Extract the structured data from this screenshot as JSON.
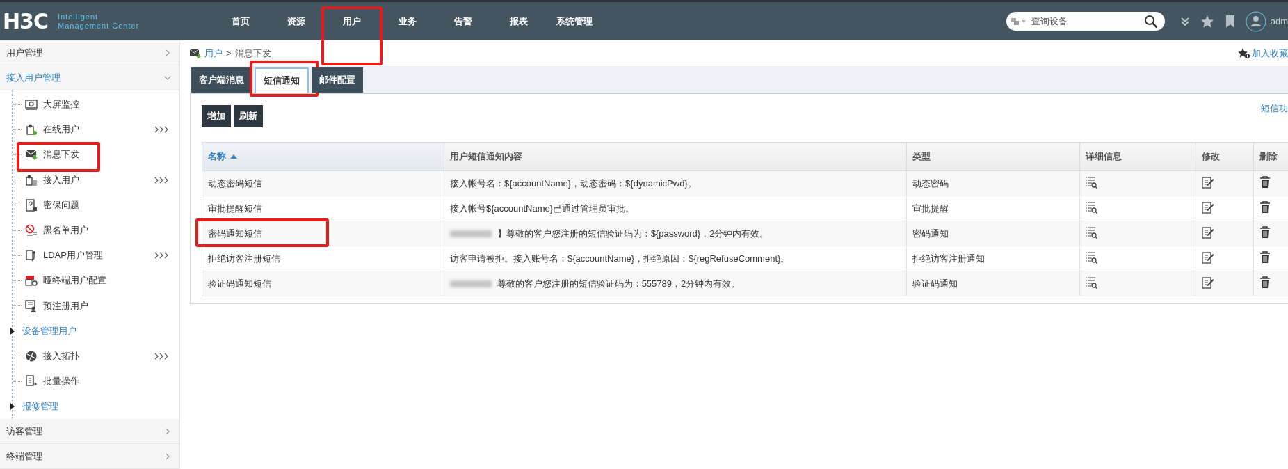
{
  "header": {
    "logo": "H3C",
    "product_line1": "Intelligent",
    "product_line2": "Management Center",
    "nav": [
      {
        "label": "首页",
        "highlighted": false
      },
      {
        "label": "资源",
        "highlighted": false
      },
      {
        "label": "用户",
        "highlighted": true
      },
      {
        "label": "业务",
        "highlighted": false
      },
      {
        "label": "告警",
        "highlighted": false
      },
      {
        "label": "报表",
        "highlighted": false
      },
      {
        "label": "系统管理",
        "highlighted": false
      }
    ],
    "search": {
      "placeholder": "查询设备"
    },
    "user": "adm"
  },
  "sidebar": {
    "groups": [
      {
        "label": "用户管理",
        "expanded": false
      },
      {
        "label": "接入用户管理",
        "expanded": true,
        "children": [
          {
            "kind": "item",
            "label": "大屏监控",
            "more": false,
            "highlighted": false
          },
          {
            "kind": "item",
            "label": "在线用户",
            "more": true,
            "highlighted": false
          },
          {
            "kind": "item",
            "label": "消息下发",
            "more": false,
            "highlighted": true
          },
          {
            "kind": "item",
            "label": "接入用户",
            "more": true,
            "highlighted": false
          },
          {
            "kind": "item",
            "label": "密保问题",
            "more": false,
            "highlighted": false
          },
          {
            "kind": "item",
            "label": "黑名单用户",
            "more": false,
            "highlighted": false
          },
          {
            "kind": "item",
            "label": "LDAP用户管理",
            "more": true,
            "highlighted": false
          },
          {
            "kind": "item",
            "label": "哑终端用户配置",
            "more": false,
            "highlighted": false
          },
          {
            "kind": "item",
            "label": "预注册用户",
            "more": false,
            "highlighted": false
          },
          {
            "kind": "group",
            "label": "设备管理用户",
            "expanded": false
          },
          {
            "kind": "item",
            "label": "接入拓扑",
            "more": true,
            "highlighted": false
          },
          {
            "kind": "item",
            "label": "批量操作",
            "more": false,
            "highlighted": false
          },
          {
            "kind": "group",
            "label": "报修管理",
            "expanded": false
          }
        ]
      },
      {
        "label": "访客管理",
        "expanded": false
      },
      {
        "label": "终端管理",
        "expanded": false
      }
    ]
  },
  "breadcrumb": {
    "items": [
      "用户",
      "消息下发"
    ],
    "separator": ">"
  },
  "favorite_link": "加入收藏",
  "tabs": [
    {
      "label": "客户端消息",
      "selected": false,
      "highlighted": false
    },
    {
      "label": "短信通知",
      "selected": true,
      "highlighted": true
    },
    {
      "label": "邮件配置",
      "selected": false,
      "highlighted": false
    }
  ],
  "toolbar": {
    "buttons": [
      "增加",
      "刷新"
    ],
    "side_link": "短信功"
  },
  "table": {
    "columns": [
      {
        "label": "名称",
        "sorted": true
      },
      {
        "label": "用户短信通知内容",
        "sorted": false
      },
      {
        "label": "类型",
        "sorted": false
      },
      {
        "label": "详细信息",
        "sorted": false
      },
      {
        "label": "修改",
        "sorted": false
      },
      {
        "label": "删除",
        "sorted": false
      }
    ],
    "rows": [
      {
        "name": "动态密码短信",
        "content": "接入帐号名：${accountName}，动态密码：${dynamicPwd}。",
        "type": "动态密码",
        "redacted": false,
        "highlighted": false
      },
      {
        "name": "审批提醒短信",
        "content": "接入帐号${accountName}已通过管理员审批。",
        "type": "审批提醒",
        "redacted": false,
        "highlighted": false
      },
      {
        "name": "密码通知短信",
        "content": "】尊敬的客户您注册的短信验证码为：${password}，2分钟内有效。",
        "type": "密码通知",
        "redacted": true,
        "highlighted": true
      },
      {
        "name": "拒绝访客注册短信",
        "content": "访客申请被拒。接入账号名：${accountName}，拒绝原因：${regRefuseComment}。",
        "type": "拒绝访客注册通知",
        "redacted": false,
        "highlighted": false
      },
      {
        "name": "验证码通知短信",
        "content": "尊敬的客户您注册的短信验证码为：555789，2分钟内有效。",
        "type": "验证码通知",
        "redacted": true,
        "highlighted": false
      }
    ]
  }
}
